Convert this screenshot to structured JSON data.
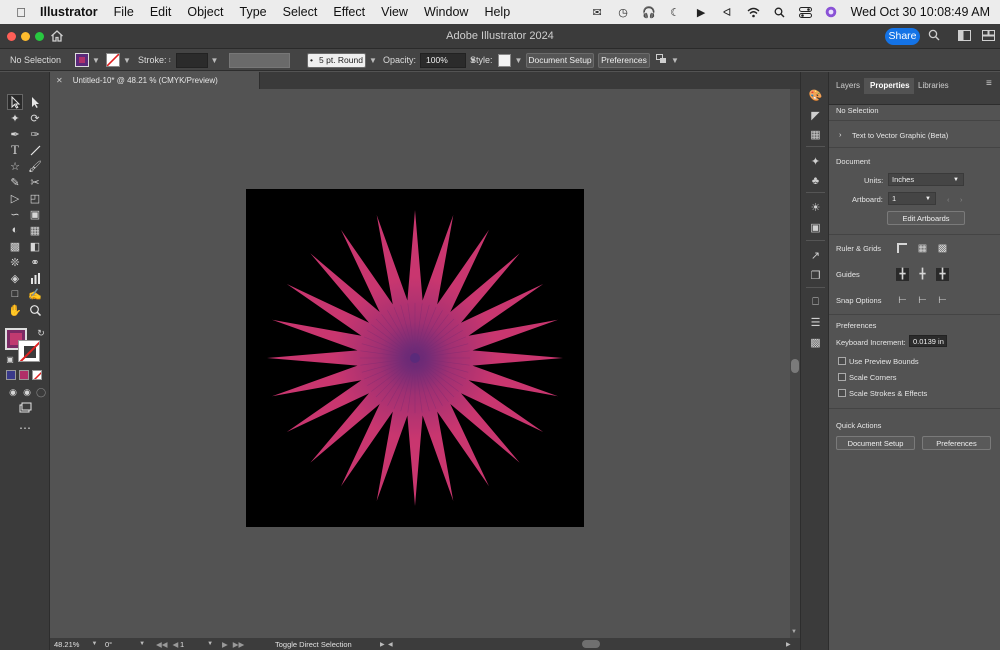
{
  "menubar": {
    "app_name": "Illustrator",
    "items": [
      "File",
      "Edit",
      "Object",
      "Type",
      "Select",
      "Effect",
      "View",
      "Window",
      "Help"
    ],
    "clock": "Wed Oct 30  10:08:49 AM"
  },
  "titlebar": {
    "title": "Adobe Illustrator 2024",
    "share_label": "Share"
  },
  "controlbar": {
    "selection": "No Selection",
    "fill_color": "#b0306a",
    "stroke_label": "Stroke:",
    "brush_value": "5 pt. Round",
    "opacity_label": "Opacity:",
    "opacity_value": "100%",
    "style_label": "Style:",
    "document_setup": "Document Setup",
    "preferences": "Preferences"
  },
  "document_tab": {
    "title": "Untitled-10* @ 48.21 % (CMYK/Preview)"
  },
  "artwork": {
    "ray_color": "#c9366f",
    "center_color": "#5a2a7a",
    "background": "#000000"
  },
  "statusbar": {
    "zoom": "48.21%",
    "rotation": "0°",
    "artboard": "1",
    "status_text": "Toggle Direct Selection"
  },
  "panel": {
    "tabs": [
      "Layers",
      "Properties",
      "Libraries"
    ],
    "active_tab": "Properties",
    "selection": "No Selection",
    "text_to_vector": "Text to Vector Graphic (Beta)",
    "document_heading": "Document",
    "units_label": "Units:",
    "units_value": "Inches",
    "artboard_label": "Artboard:",
    "artboard_value": "1",
    "edit_artboards": "Edit Artboards",
    "ruler_grids": "Ruler & Grids",
    "guides": "Guides",
    "snap_options": "Snap Options",
    "preferences_heading": "Preferences",
    "keyboard_increment_label": "Keyboard Increment:",
    "keyboard_increment_value": "0.0139 in",
    "use_preview_bounds": "Use Preview Bounds",
    "scale_corners": "Scale Corners",
    "scale_strokes": "Scale Strokes & Effects",
    "quick_actions": "Quick Actions",
    "qa_document_setup": "Document Setup",
    "qa_preferences": "Preferences"
  }
}
